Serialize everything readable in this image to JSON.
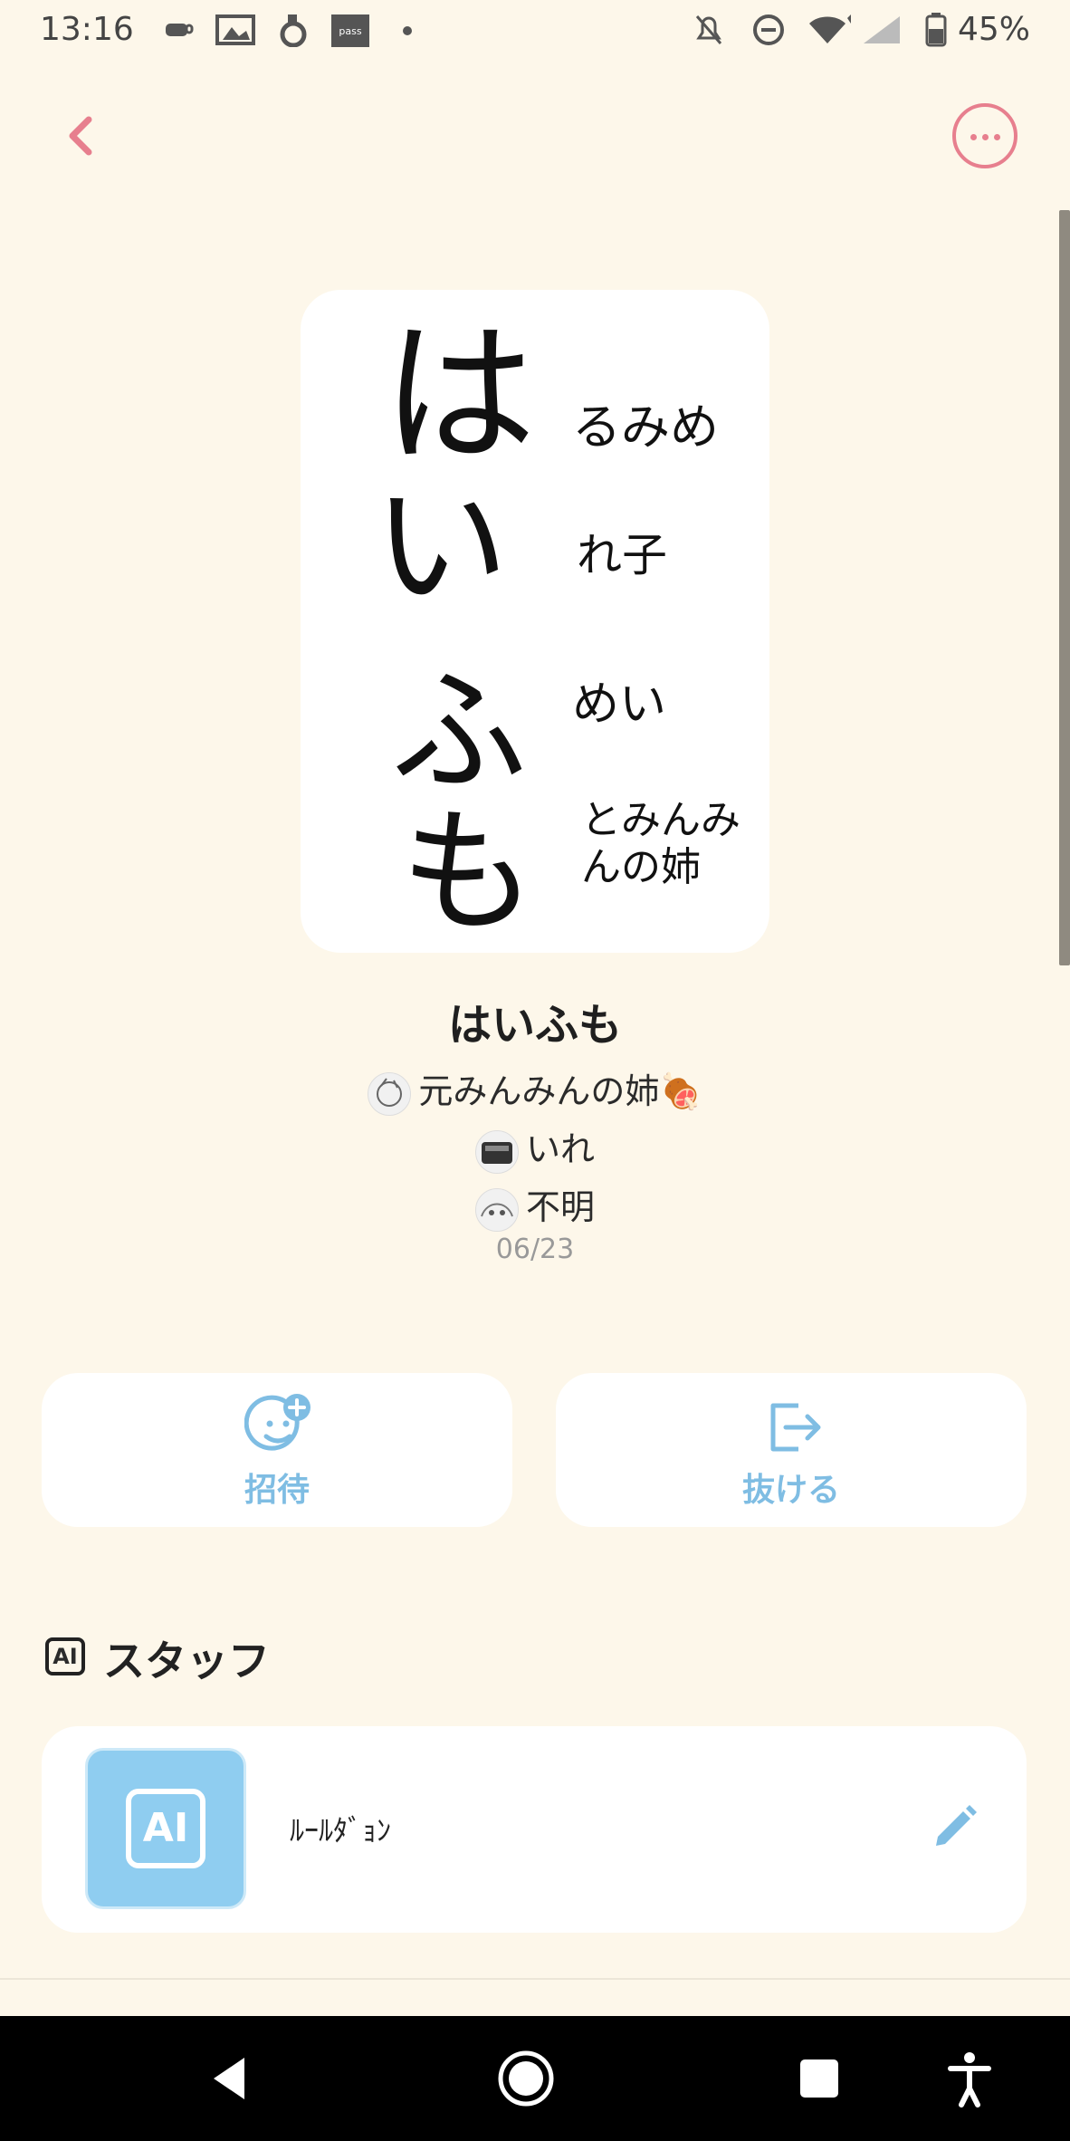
{
  "status_bar": {
    "time": "13:16",
    "battery": "45%",
    "icons": [
      "coffee-icon",
      "gallery-icon",
      "app-icon",
      "pass-icon",
      "dot-icon",
      "bell-off-icon",
      "do-not-disturb-icon",
      "wifi-icon",
      "signal-icon",
      "battery-icon"
    ]
  },
  "header": {
    "back_icon": "chevron-left-icon",
    "more_icon": "more-horizontal-icon",
    "accent_color": "#e77f8e"
  },
  "group": {
    "name": "はいふも",
    "image_text": {
      "big": [
        "は",
        "い",
        "ふ",
        "も"
      ],
      "small": [
        "るみめ",
        "れ子",
        "めい",
        "とみんみ",
        "んの姉"
      ]
    },
    "members": [
      {
        "label": "元みんみんの姉🍖"
      },
      {
        "label": "いれ"
      },
      {
        "label": "不明"
      }
    ],
    "date": "06/23"
  },
  "actions": {
    "invite_label": "招待",
    "leave_label": "抜ける",
    "color": "#7fbde3"
  },
  "staff": {
    "heading": "スタッフ",
    "heading_icon": "AI",
    "avatar_text": "AI",
    "name": "ﾙｰﾙﾀﾞｮﾝ",
    "edit_icon": "pencil-icon"
  },
  "nav_bar": {
    "icons": [
      "back-triangle-icon",
      "home-circle-icon",
      "recents-square-icon",
      "accessibility-icon"
    ]
  }
}
